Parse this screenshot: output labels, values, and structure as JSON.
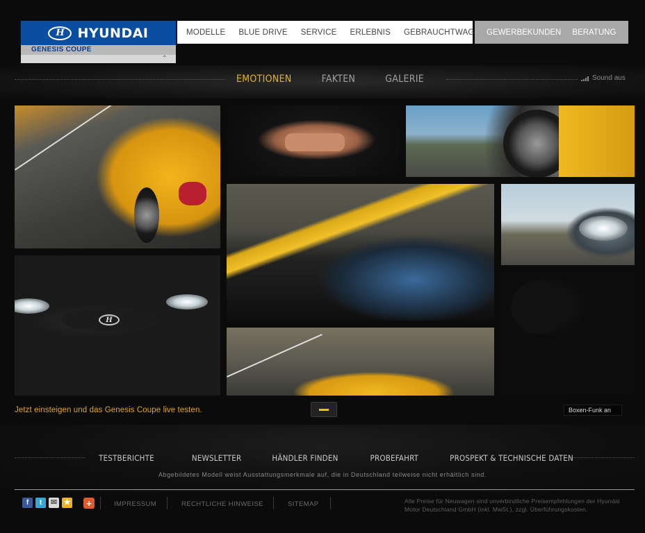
{
  "brand": {
    "name": "HYUNDAI",
    "model": "GENESIS COUPE"
  },
  "main_nav": [
    "MODELLE",
    "BLUE DRIVE",
    "SERVICE",
    "ERLEBNIS",
    "GEBRAUCHTWAGEN"
  ],
  "sub_nav": [
    "GEWERBEKUNDEN",
    "BERATUNG"
  ],
  "tabs": {
    "items": [
      "EMOTIONEN",
      "FAKTEN",
      "GALERIE"
    ],
    "active": "EMOTIONEN"
  },
  "sound": {
    "label": "Sound aus"
  },
  "gallery": {
    "cta": "Jetzt einsteigen und das Genesis Coupe live testen.",
    "boxen_funk": "Boxen-Funk an"
  },
  "footer": {
    "links": [
      "TESTBERICHTE",
      "NEWSLETTER",
      "HÄNDLER FINDEN",
      "PROBEFAHRT",
      "PROSPEKT & TECHNISCHE DATEN"
    ],
    "disclaimer": "Abgebildetes Modell weist Ausstattungsmerkmale auf, die in Deutschland teilweise nicht erhältlich sind.",
    "legal": [
      "IMPRESSUM",
      "RECHTLICHE HINWEISE",
      "SITEMAP"
    ],
    "prices": "Alle Preise für Neuwagen sind unverbindliche Preisempfehlungen der Hyundai Motor Deutschland GmbH (inkl. MwSt.), zzgl. Überführungskosten."
  },
  "social_icons": [
    "facebook-icon",
    "twitter-icon",
    "email-icon",
    "favorite-icon"
  ],
  "colors": {
    "brand_blue": "#0a4ea2",
    "accent_gold": "#e8b020",
    "background": "#0b0b0b"
  }
}
